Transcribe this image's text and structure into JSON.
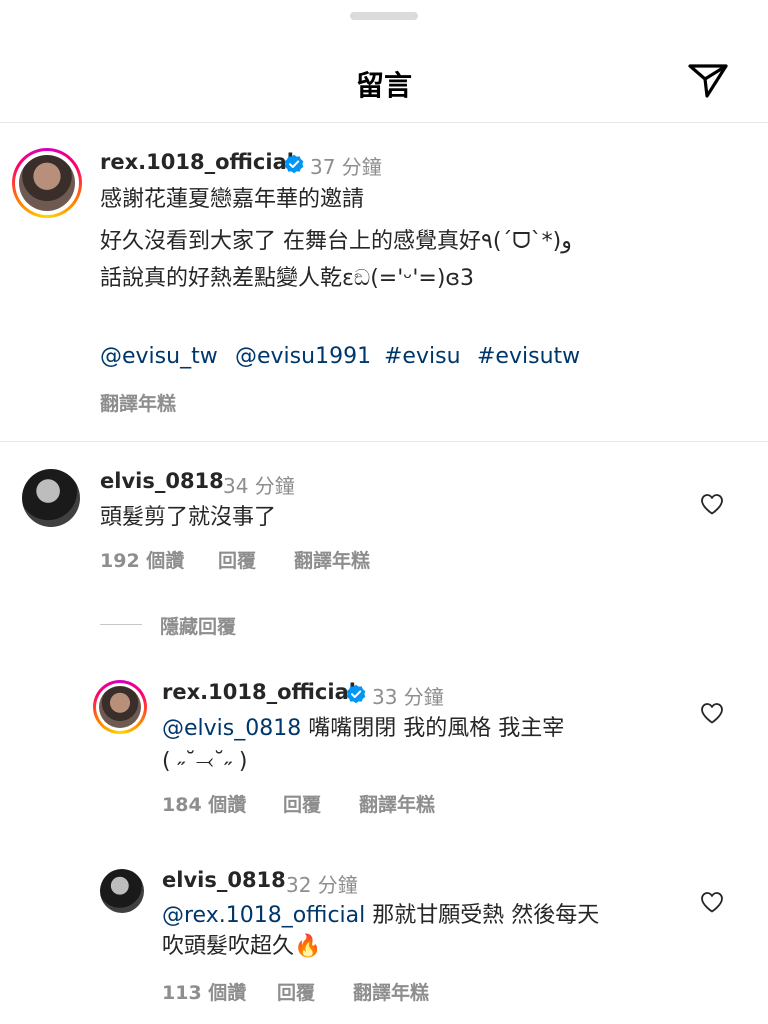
{
  "header": {
    "title": "留言"
  },
  "caption": {
    "username": "rex.1018_official",
    "time": "37 分鐘",
    "lines": [
      "感謝花蓮夏戀嘉年華的邀請",
      "好久沒看到大家了 在舞台上的感覺真好٩(ˊᗜˋ*)و",
      "話說真的好熱差點變人乾ɛඞ(='ᵕ'=)ɞ3"
    ],
    "tags": [
      "@evisu_tw",
      "@evisu1991",
      "#evisu",
      "#evisutw"
    ],
    "translate": "翻譯年糕"
  },
  "comments": [
    {
      "username": "elvis_0818",
      "time": "34 分鐘",
      "text": "頭髮剪了就沒事了",
      "likes": "192 個讚",
      "reply": "回覆",
      "translate": "翻譯年糕"
    }
  ],
  "hide_replies": "隱藏回覆",
  "replies": [
    {
      "username": "rex.1018_official",
      "time": "33 分鐘",
      "mention": "@elvis_0818",
      "text": " 嘴嘴閉閉 我的風格 我主宰",
      "text2": "( ˶˘⤙˘˶ )",
      "likes": "184 個讚",
      "reply": "回覆",
      "translate": "翻譯年糕"
    },
    {
      "username": "elvis_0818",
      "time": "32 分鐘",
      "mention": "@rex.1018_official",
      "text": " 那就甘願受熱 然後每天",
      "text2": "吹頭髮吹超久",
      "emoji": "🔥",
      "likes": "113 個讚",
      "reply": "回覆",
      "translate": "翻譯年糕"
    }
  ],
  "colors": {
    "mention": "#00376b",
    "verified": "#0095f6",
    "muted": "#8e8e8e"
  },
  "icons": [
    "send-icon",
    "verified-badge-icon",
    "heart-icon"
  ]
}
